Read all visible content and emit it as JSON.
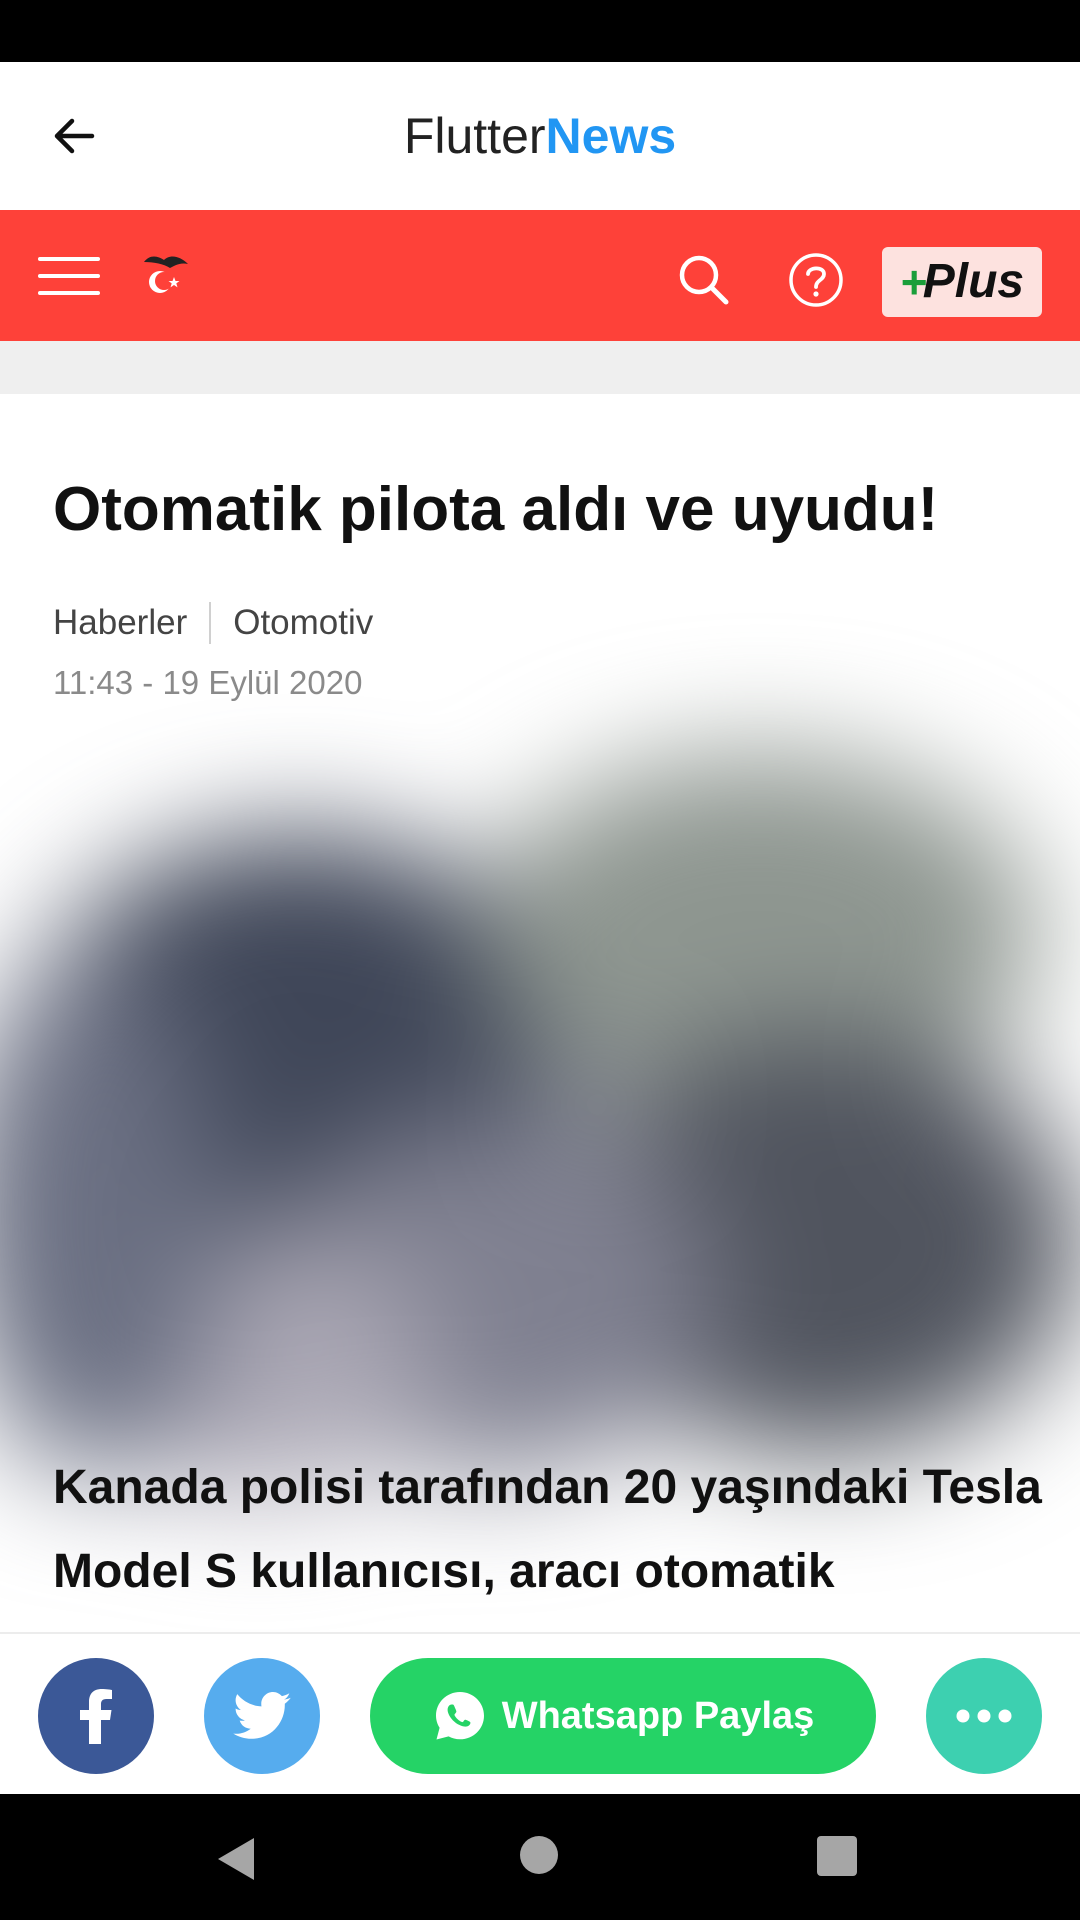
{
  "app_bar": {
    "brand_part1": "Flutter",
    "brand_part2": "News",
    "brand_accent_color": "#2196f3"
  },
  "toolbar": {
    "background_color": "#fe4139",
    "menu_icon": "hamburger-menu-icon",
    "logo_icon": "crescent-star-logo-icon",
    "search_icon": "search-icon",
    "help_icon": "question-circle-icon",
    "plus_sign": "+",
    "plus_label": "Plus",
    "plus_sign_color": "#1a9e3a"
  },
  "article": {
    "title": "Otomatik pilota aldı ve uyudu!",
    "category": "Haberler",
    "subcategory": "Otomotiv",
    "datetime": "11:43 - 19 Eylül 2020",
    "image": "blurred-article-photo",
    "lead": "Kanada polisi tarafından 20 yaşındaki Tesla Model S kullanıcısı, aracı otomatik"
  },
  "share_bar": {
    "facebook_icon": "facebook-icon",
    "facebook_color": "#3b5897",
    "twitter_icon": "twitter-icon",
    "twitter_color": "#56acee",
    "whatsapp_icon": "whatsapp-icon",
    "whatsapp_label": "Whatsapp Paylaş",
    "whatsapp_color": "#25d366",
    "more_icon": "more-dots-icon",
    "more_color": "#3dd0b0"
  },
  "system_nav": {
    "back_icon": "nav-back-triangle-icon",
    "home_icon": "nav-home-circle-icon",
    "recents_icon": "nav-recents-square-icon"
  }
}
